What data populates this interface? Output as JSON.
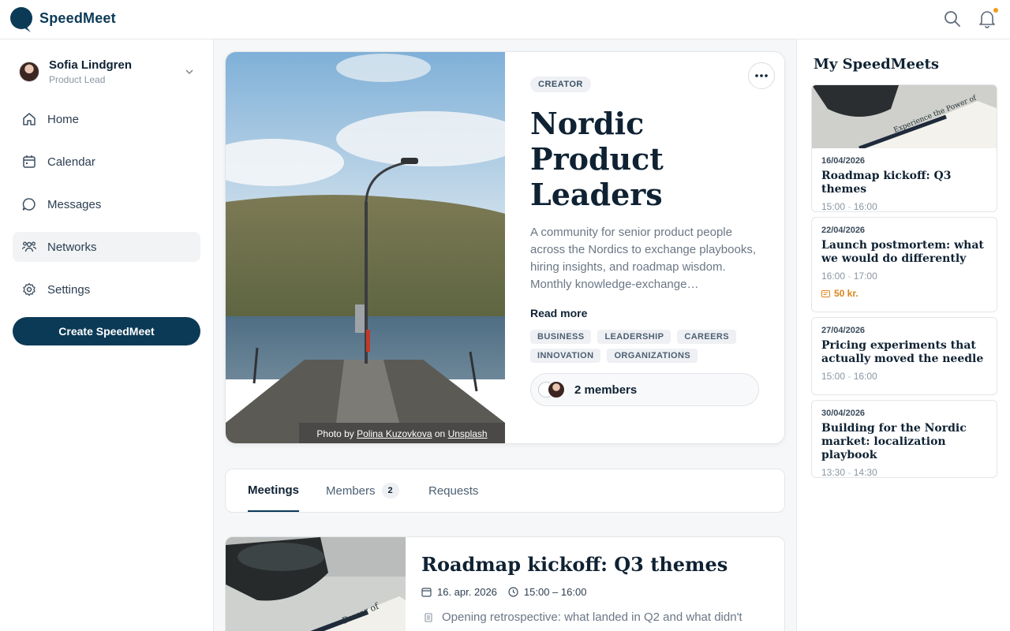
{
  "app": {
    "brand": "SpeedMeet"
  },
  "user": {
    "name": "Sofia Lindgren",
    "role": "Product Lead"
  },
  "nav": [
    {
      "label": "Home",
      "icon": "home-icon"
    },
    {
      "label": "Calendar",
      "icon": "calendar-icon"
    },
    {
      "label": "Messages",
      "icon": "message-icon"
    },
    {
      "label": "Networks",
      "icon": "users-icon",
      "active": true
    },
    {
      "label": "Settings",
      "icon": "gear-icon"
    }
  ],
  "create_button": "Create SpeedMeet",
  "network": {
    "badge": "CREATOR",
    "title": "Nordic Product Leaders",
    "description": "A community for senior product people across the Nordics to exchange playbooks, hiring insights, and roadmap wisdom. Monthly knowledge-exchange…",
    "read_more": "Read more",
    "tags": [
      "BUSINESS",
      "LEADERSHIP",
      "CAREERS",
      "INNOVATION",
      "ORGANIZATIONS"
    ],
    "members_label": "2 members",
    "photo_credit": {
      "prefix": "Photo by",
      "author": "Polina Kuzovkova",
      "on": "on",
      "site": "Unsplash"
    }
  },
  "tabs": [
    {
      "label": "Meetings",
      "active": true
    },
    {
      "label": "Members",
      "count": "2"
    },
    {
      "label": "Requests"
    }
  ],
  "featured_meeting": {
    "title": "Roadmap kickoff: Q3 themes",
    "date": "16. apr. 2026",
    "time": "15:00 – 16:00",
    "description": "Opening retrospective: what landed in Q2 and what didn't"
  },
  "my_speedmeets": {
    "title": "My SpeedMeets",
    "items": [
      {
        "date": "16/04/2026",
        "title": "Roadmap kickoff: Q3 themes",
        "start": "15:00",
        "end": "16:00",
        "has_image": true
      },
      {
        "date": "22/04/2026",
        "title": "Launch postmortem: what we would do differently",
        "start": "16:00",
        "end": "17:00",
        "price": "50 kr."
      },
      {
        "date": "27/04/2026",
        "title": "Pricing experiments that actually moved the needle",
        "start": "15:00",
        "end": "16:00"
      },
      {
        "date": "30/04/2026",
        "title": "Building for the Nordic market: localization playbook",
        "start": "13:30",
        "end": "14:30"
      }
    ]
  },
  "colors": {
    "primary": "#0b3a57",
    "accent": "#f29b1c",
    "price": "#d9861c"
  }
}
